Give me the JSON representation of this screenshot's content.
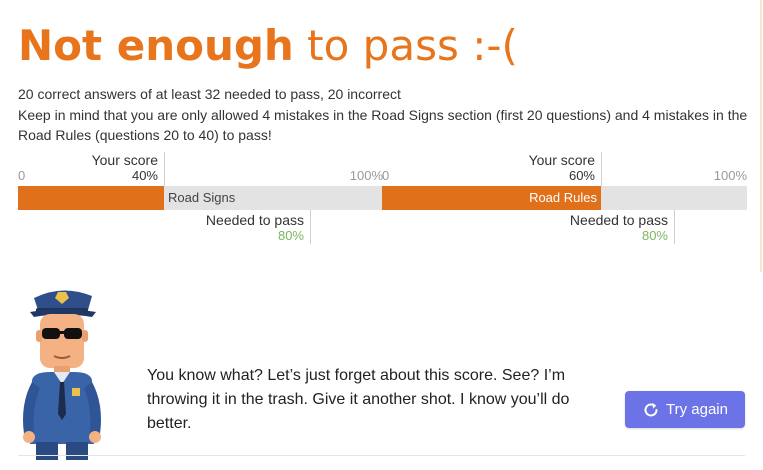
{
  "result": {
    "title_strong": "Not enough",
    "title_rest": " to pass :-("
  },
  "summary": {
    "line1": "20 correct answers of at least 32 needed to pass, 20 incorrect",
    "line2": "Keep in mind that you are only allowed 4 mistakes in the Road Signs section (first 20 questions) and 4 mistakes in the Road Rules (questions 20 to 40) to pass!"
  },
  "sections": [
    {
      "name": "Road Signs",
      "score_fraction": 0.4,
      "needed_fraction": 0.8,
      "your_score_label": "Your score",
      "your_score_value": "40%",
      "needed_label": "Needed to pass",
      "needed_value": "80%",
      "min_label": "0",
      "max_label": "100%"
    },
    {
      "name": "Road Rules",
      "score_fraction": 0.6,
      "needed_fraction": 0.8,
      "your_score_label": "Your score",
      "your_score_value": "60%",
      "needed_label": "Needed to pass",
      "needed_value": "80%",
      "min_label": "0",
      "max_label": "100%"
    }
  ],
  "message": "You know what? Let’s just forget about this score. See? I’m throwing it in the trash. Give it another shot. I know you’ll do better.",
  "try_again": {
    "label": "Try again",
    "icon": "refresh-icon"
  },
  "colors": {
    "accent_orange": "#e8741b",
    "bar_fill": "#e0701a",
    "bar_track": "#e3e3e3",
    "pass_green": "#7bb661",
    "button_purple": "#6c73e6"
  }
}
